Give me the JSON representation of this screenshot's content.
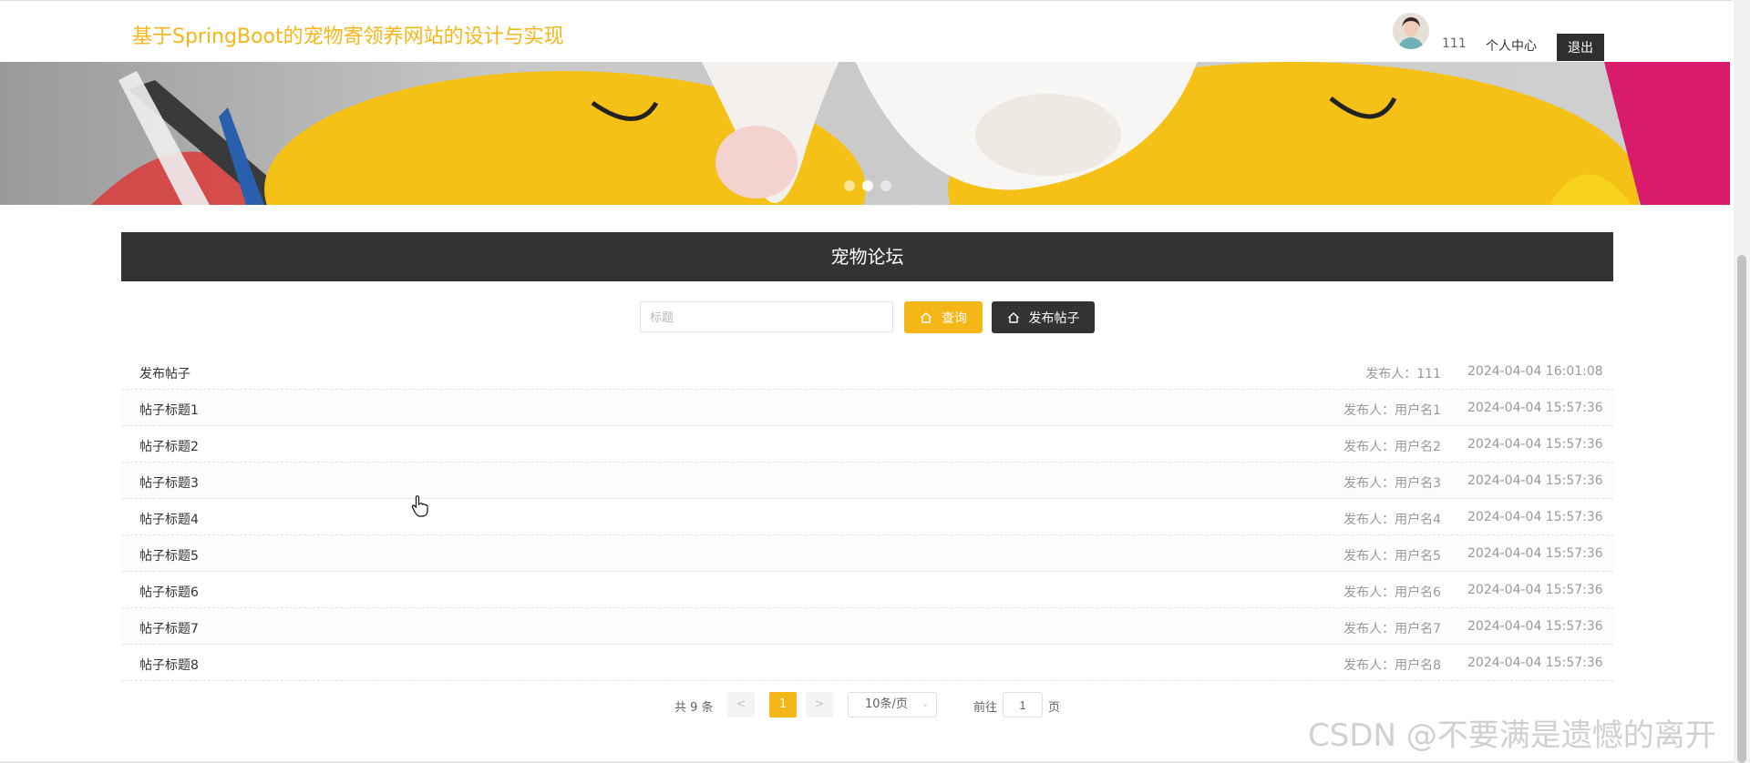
{
  "header": {
    "title": "基于SpringBoot的宠物寄领养网站的设计与实现",
    "username": "111",
    "profile_label": "个人中心",
    "logout_label": "退出"
  },
  "banner": {
    "active_slide": 2,
    "slide_count": 3
  },
  "section": {
    "title": "宠物论坛"
  },
  "search": {
    "placeholder": "标题",
    "query_label": "查询",
    "post_label": "发布帖子"
  },
  "posts": [
    {
      "title": "发布帖子",
      "author": "发布人：111",
      "time": "2024-04-04 16:01:08"
    },
    {
      "title": "帖子标题1",
      "author": "发布人：用户名1",
      "time": "2024-04-04 15:57:36"
    },
    {
      "title": "帖子标题2",
      "author": "发布人：用户名2",
      "time": "2024-04-04 15:57:36"
    },
    {
      "title": "帖子标题3",
      "author": "发布人：用户名3",
      "time": "2024-04-04 15:57:36"
    },
    {
      "title": "帖子标题4",
      "author": "发布人：用户名4",
      "time": "2024-04-04 15:57:36"
    },
    {
      "title": "帖子标题5",
      "author": "发布人：用户名5",
      "time": "2024-04-04 15:57:36"
    },
    {
      "title": "帖子标题6",
      "author": "发布人：用户名6",
      "time": "2024-04-04 15:57:36"
    },
    {
      "title": "帖子标题7",
      "author": "发布人：用户名7",
      "time": "2024-04-04 15:57:36"
    },
    {
      "title": "帖子标题8",
      "author": "发布人：用户名8",
      "time": "2024-04-04 15:57:36"
    }
  ],
  "pagination": {
    "total": "共 9 条",
    "prev": "<",
    "current": "1",
    "next": ">",
    "page_size": "10条/页",
    "goto_label": "前往",
    "goto_value": "1",
    "page_label": "页"
  },
  "watermark": "CSDN @不要满是遗憾的离开",
  "colors": {
    "accent": "#f5b617",
    "dark": "#333333"
  }
}
